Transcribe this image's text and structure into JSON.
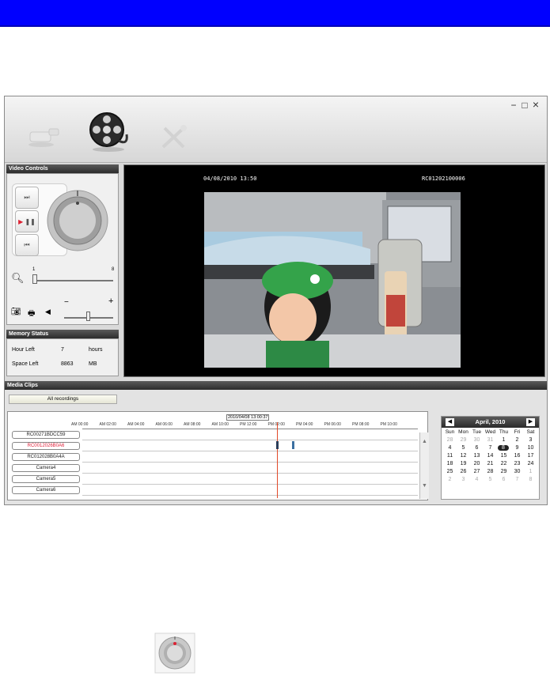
{
  "window": {
    "minimize_icon": "−",
    "maximize_icon": "□",
    "close_icon": "×"
  },
  "video_controls": {
    "title": "Video Controls",
    "zoom_min": "1",
    "zoom_max": "8",
    "vol_minus": "−",
    "vol_plus": "+"
  },
  "memory_status": {
    "title": "Memory Status",
    "hour_left_label": "Hour Left",
    "hour_left_value": "7",
    "hour_left_unit": "hours",
    "space_left_label": "Space Left",
    "space_left_value": "8863",
    "space_left_unit": "MB"
  },
  "video": {
    "osd_datetime": "04/08/2010 13:50",
    "osd_camera": "RC01202100006"
  },
  "media_clips": {
    "title": "Media Clips",
    "all_recordings_button": "All recordings",
    "cursor_time": "2010/04/08 13:00:37",
    "ticks": [
      "AM 00:00",
      "AM 02:00",
      "AM 04:00",
      "AM 06:00",
      "AM 08:00",
      "AM 10:00",
      "PM 12:00",
      "PM 02:00",
      "PM 04:00",
      "PM 06:00",
      "PM 08:00",
      "PM 10:00"
    ],
    "cameras": [
      {
        "name": "RC00271BDCC59",
        "active": false
      },
      {
        "name": "RC0012026B0A6",
        "active": true
      },
      {
        "name": "RC012028B0A4A",
        "active": false
      },
      {
        "name": "Camera4",
        "active": false
      },
      {
        "name": "Camera5",
        "active": false
      },
      {
        "name": "Camera6",
        "active": false
      }
    ]
  },
  "calendar": {
    "month_label": "April, 2010",
    "weekdays": [
      "Sun",
      "Mon",
      "Tue",
      "Wed",
      "Thu",
      "Fri",
      "Sat"
    ],
    "weeks": [
      [
        "28",
        "29",
        "30",
        "31",
        "1",
        "2",
        "3"
      ],
      [
        "4",
        "5",
        "6",
        "7",
        "8",
        "9",
        "10"
      ],
      [
        "11",
        "12",
        "13",
        "14",
        "15",
        "16",
        "17"
      ],
      [
        "18",
        "19",
        "20",
        "21",
        "22",
        "23",
        "24"
      ],
      [
        "25",
        "26",
        "27",
        "28",
        "29",
        "30",
        "1"
      ],
      [
        "2",
        "3",
        "4",
        "5",
        "6",
        "7",
        "8"
      ]
    ],
    "selected_day": "8"
  }
}
